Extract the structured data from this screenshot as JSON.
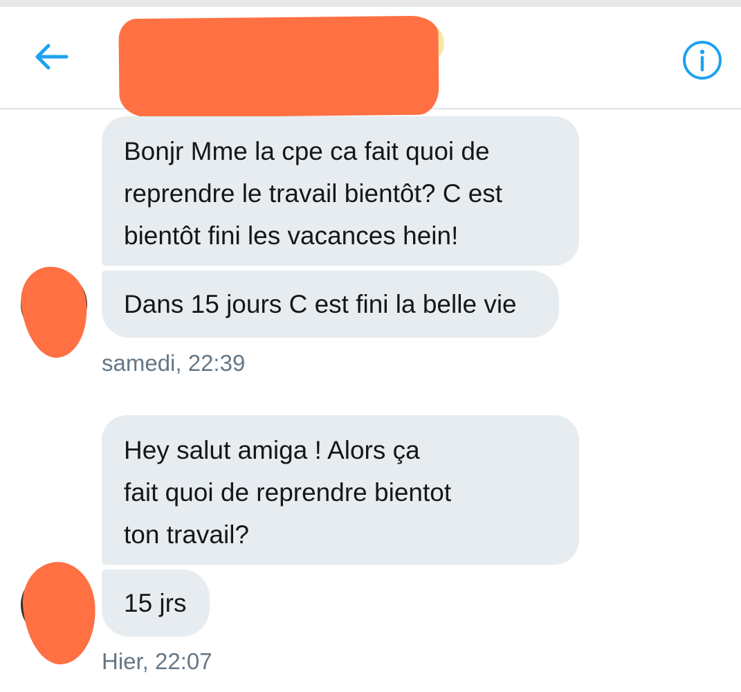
{
  "header": {
    "back_icon": "arrow-left-icon",
    "info_icon": "info-circle-icon",
    "accent_color": "#1da1f2"
  },
  "redaction_color": "#ff7043",
  "messages": [
    {
      "text": "Bonjr Mme la cpe ca fait quoi de\nreprendre le travail bientôt? C est\nbientôt  fini les vacances hein!"
    },
    {
      "text": "Dans 15 jours C est fini la belle vie",
      "timestamp": "samedi, 22:39"
    },
    {
      "text": "Hey salut  amiga ! Alors ça\nfait quoi de reprendre bientot\nton travail?"
    },
    {
      "text": "15 jrs",
      "timestamp": "Hier, 22:07"
    }
  ]
}
